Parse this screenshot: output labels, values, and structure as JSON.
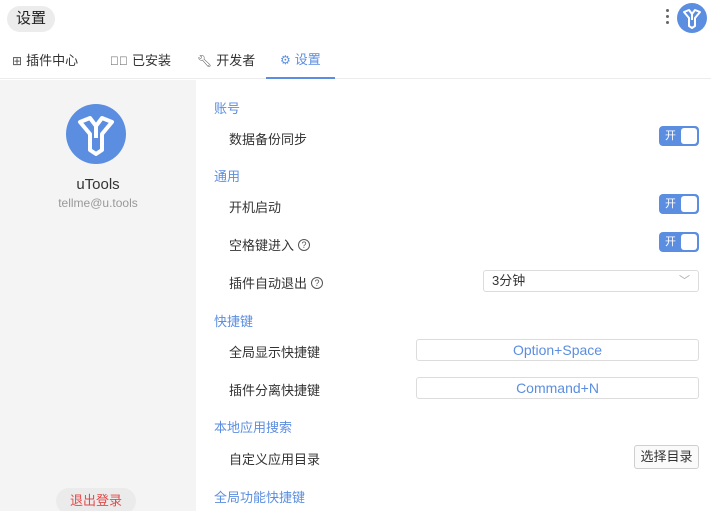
{
  "window": {
    "title": "设置"
  },
  "tabs": [
    {
      "label": "插件中心",
      "icon": "grid-icon"
    },
    {
      "label": "已安装",
      "icon": "check-circle-icon"
    },
    {
      "label": "开发者",
      "icon": "wrench-icon"
    },
    {
      "label": "设置",
      "icon": "gear-icon",
      "active": true
    }
  ],
  "sidebar": {
    "name": "uTools",
    "email": "tellme@u.tools",
    "logout_label": "退出登录"
  },
  "settings": {
    "account": {
      "title": "账号",
      "backup_label": "数据备份同步",
      "backup_toggle": "开"
    },
    "general": {
      "title": "通用",
      "autostart_label": "开机启动",
      "autostart_toggle": "开",
      "space_label": "空格键进入",
      "space_toggle": "开",
      "autoquit_label": "插件自动退出",
      "autoquit_value": "3分钟"
    },
    "shortcuts": {
      "title": "快捷键",
      "global_label": "全局显示快捷键",
      "global_value": "Option+Space",
      "detach_label": "插件分离快捷键",
      "detach_value": "Command+N"
    },
    "local_search": {
      "title": "本地应用搜索",
      "custom_dir_label": "自定义应用目录",
      "choose_dir_label": "选择目录"
    },
    "global_func": {
      "title": "全局功能快捷键"
    }
  },
  "colors": {
    "accent": "#5b8ee0",
    "logout": "#e34a4a",
    "sidebar_bg": "#f4f4f4"
  }
}
